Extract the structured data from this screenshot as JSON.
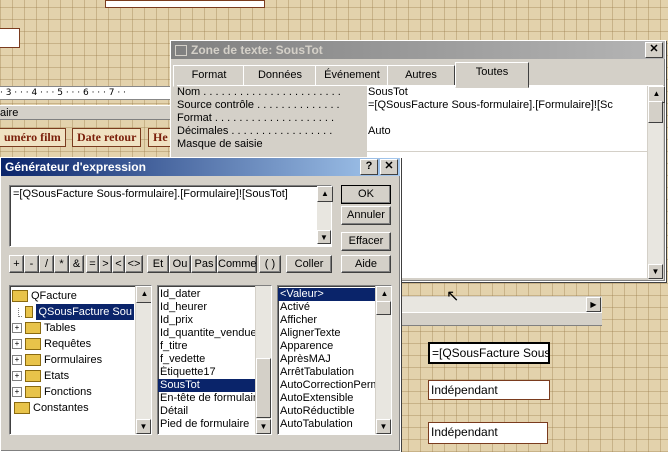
{
  "background": {
    "ruler_text": "· 3 · · · 4 · · · 5 · · · 6 · · · 7 · ·",
    "section_left_text": "aire",
    "header_labels": [
      "uméro film",
      "Date retour",
      "He"
    ],
    "controls": [
      "=[QSousFacture Sous",
      "Indépendant",
      "Indépendant"
    ]
  },
  "props_window": {
    "title": "Zone de texte: SousTot",
    "close_glyph": "✕",
    "tabs": [
      "Format",
      "Données",
      "Événement",
      "Autres",
      "Toutes"
    ],
    "active_tab": "Toutes",
    "rows": [
      {
        "label": "Nom . . . . . . . . . . . . . . . . . . . . . . .",
        "value": "SousTot"
      },
      {
        "label": "Source contrôle . . . . . . . . . . . . . .",
        "value": "=[QSousFacture Sous-formulaire].[Formulaire]![Sc"
      },
      {
        "label": "Format . . . . . . . . . . . . . . . . . . . .",
        "value": ""
      },
      {
        "label": "Décimales . . . . . . . . . . . . . . . . .",
        "value": "Auto"
      },
      {
        "label": "Masque de saisie",
        "value": ""
      }
    ],
    "partial_value": "s"
  },
  "expr_builder": {
    "title": "Générateur d'expression",
    "help_glyph": "?",
    "close_glyph": "✕",
    "expression": "=[QSousFacture Sous-formulaire].[Formulaire]![SousTot]",
    "buttons": {
      "ok": "OK",
      "cancel": "Annuler",
      "paste": "Coller",
      "help": "Aide",
      "undo": "Effacer"
    },
    "operators": [
      "+",
      "-",
      "/",
      "*",
      "&",
      "=",
      ">",
      "<",
      "<>",
      "Et",
      "Ou",
      "Pas",
      "Comme",
      "( )"
    ],
    "tree": [
      {
        "label": "QFacture",
        "type": "folder-open"
      },
      {
        "label": "QSousFacture Sou",
        "type": "folder",
        "selected": true
      },
      {
        "label": "Tables",
        "type": "plus"
      },
      {
        "label": "Requêtes",
        "type": "plus"
      },
      {
        "label": "Formulaires",
        "type": "plus"
      },
      {
        "label": "Etats",
        "type": "plus"
      },
      {
        "label": "Fonctions",
        "type": "plus"
      },
      {
        "label": "Constantes",
        "type": "folder"
      }
    ],
    "fields": [
      "Id_dater",
      "Id_heurer",
      "Id_prix",
      "Id_quantite_vendue",
      "f_titre",
      "f_vedette",
      "Étiquette17",
      "SousTot",
      "En-tête de formulaire",
      "Détail",
      "Pied de formulaire"
    ],
    "selected_field": "SousTot",
    "properties": [
      "<Valeur>",
      "Activé",
      "Afficher",
      "AlignerTexte",
      "Apparence",
      "AprèsMAJ",
      "ArrêtTabulation",
      "AutoCorrectionPerm",
      "AutoExtensible",
      "AutoRéductible",
      "AutoTabulation"
    ],
    "selected_property": "<Valeur>"
  }
}
